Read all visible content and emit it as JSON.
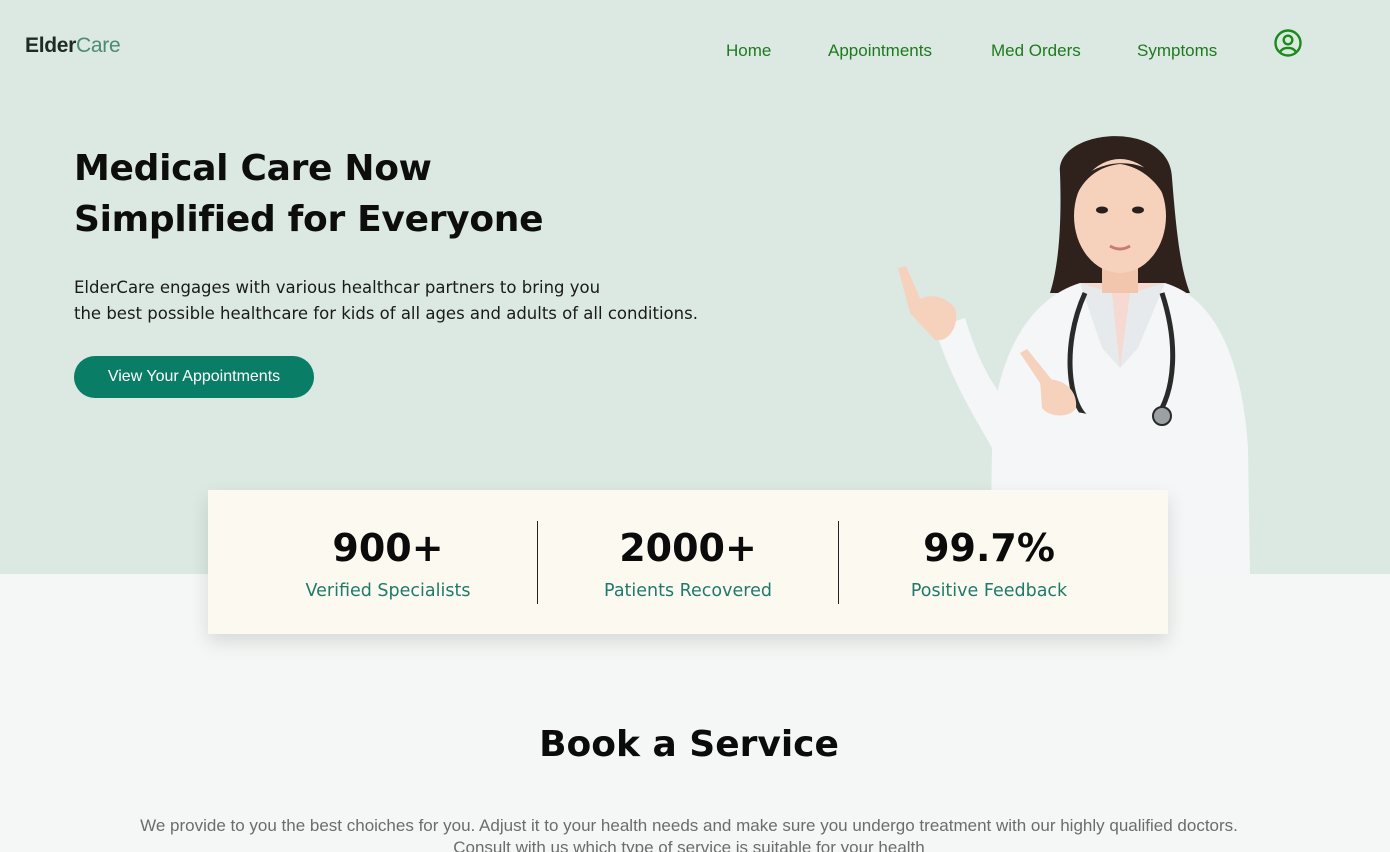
{
  "header": {
    "logo_part1": "Elder",
    "logo_part2": "Care",
    "nav": [
      "Home",
      "Appointments",
      "Med Orders",
      "Symptoms"
    ],
    "profile_icon": "user-circle-icon"
  },
  "hero": {
    "title_line1": "Medical Care Now",
    "title_line2": "Simplified for Everyone",
    "desc_line1": "ElderCare engages with various healthcar partners to bring you",
    "desc_line2": "the best possible healthcare for kids of all ages and adults of all conditions.",
    "cta_label": "View Your Appointments",
    "image": "doctor-pointing-illustration"
  },
  "stats": [
    {
      "value": "900+",
      "label": "Verified Specialists"
    },
    {
      "value": "2000+",
      "label": "Patients Recovered"
    },
    {
      "value": "99.7%",
      "label": "Positive Feedback"
    }
  ],
  "services": {
    "title": "Book a Service",
    "text_line1": "We provide to you the best choiches for you. Adjust it to your health needs and make sure you undergo treatment with our highly qualified doctors.",
    "text_line2": "Consult with us which type of service is suitable for your health"
  },
  "colors": {
    "hero_bg": "#dbe9e2",
    "accent": "#0a7d66",
    "nav_text": "#1e7a1e",
    "stat_label": "#1f7a6a",
    "stats_bg": "#fcf9f1"
  }
}
